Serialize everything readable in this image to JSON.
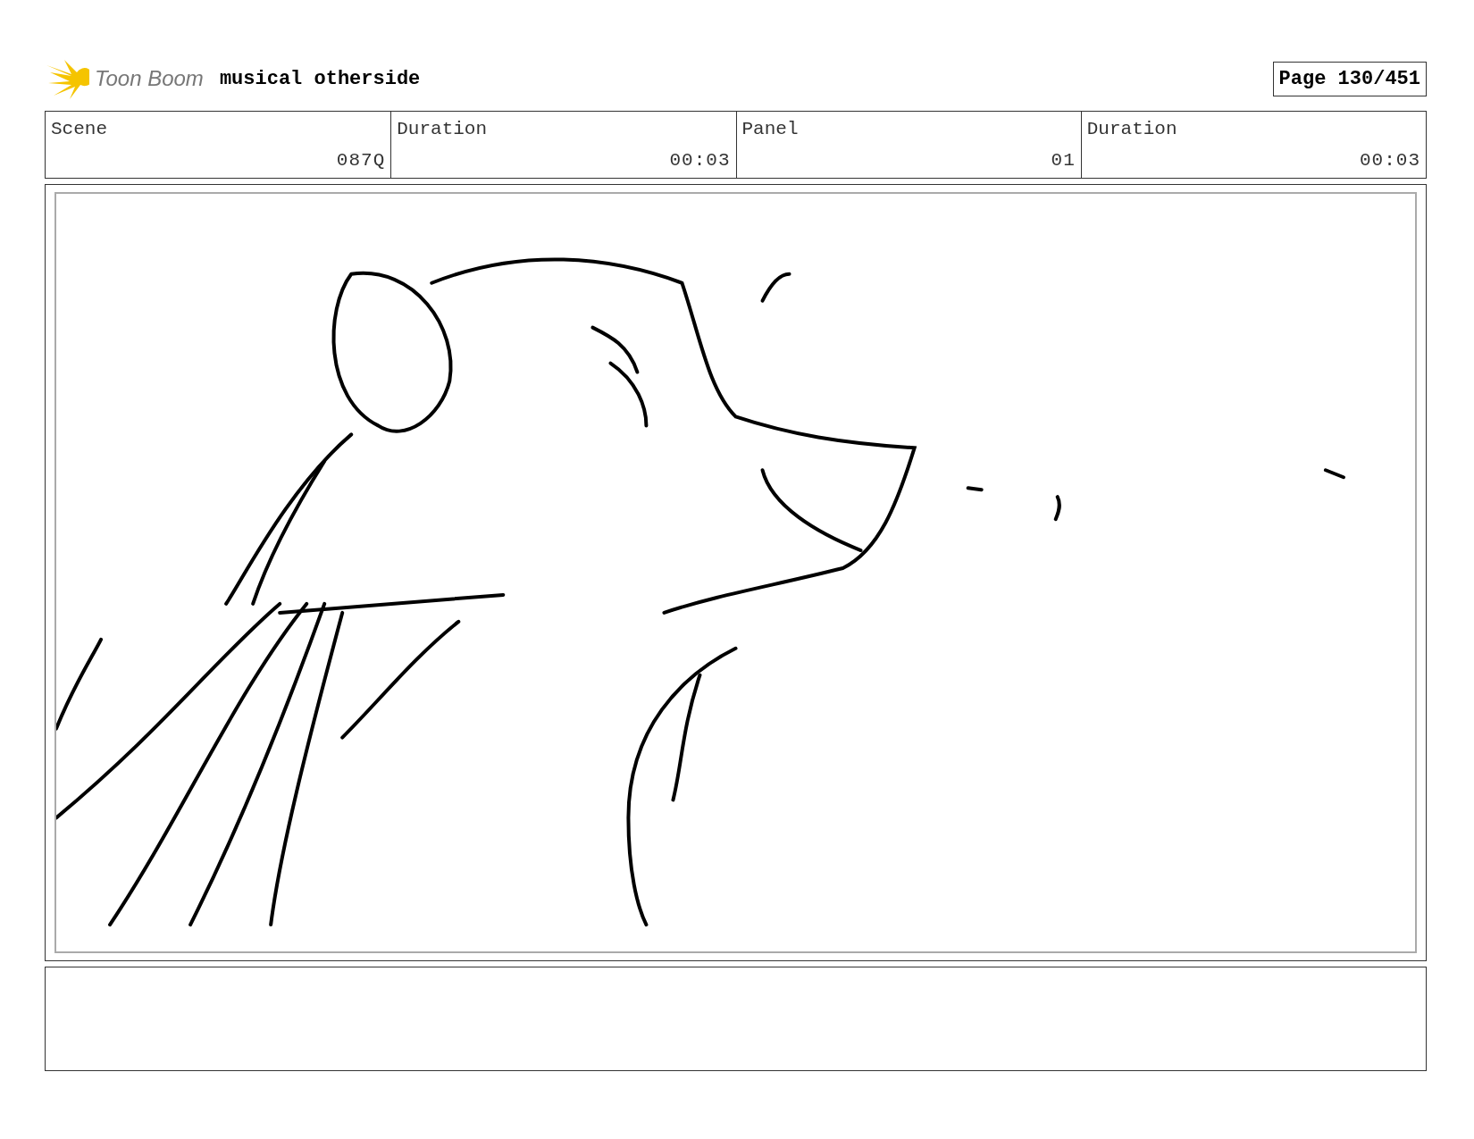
{
  "header": {
    "logo_text": "Toon Boom",
    "project_title": "musical otherside",
    "page": "Page 130/451"
  },
  "info_table": {
    "columns": [
      "Scene",
      "Duration",
      "Panel",
      "Duration"
    ],
    "rows": [
      [
        "087Q",
        "00:03",
        "01",
        "00:03"
      ]
    ]
  }
}
